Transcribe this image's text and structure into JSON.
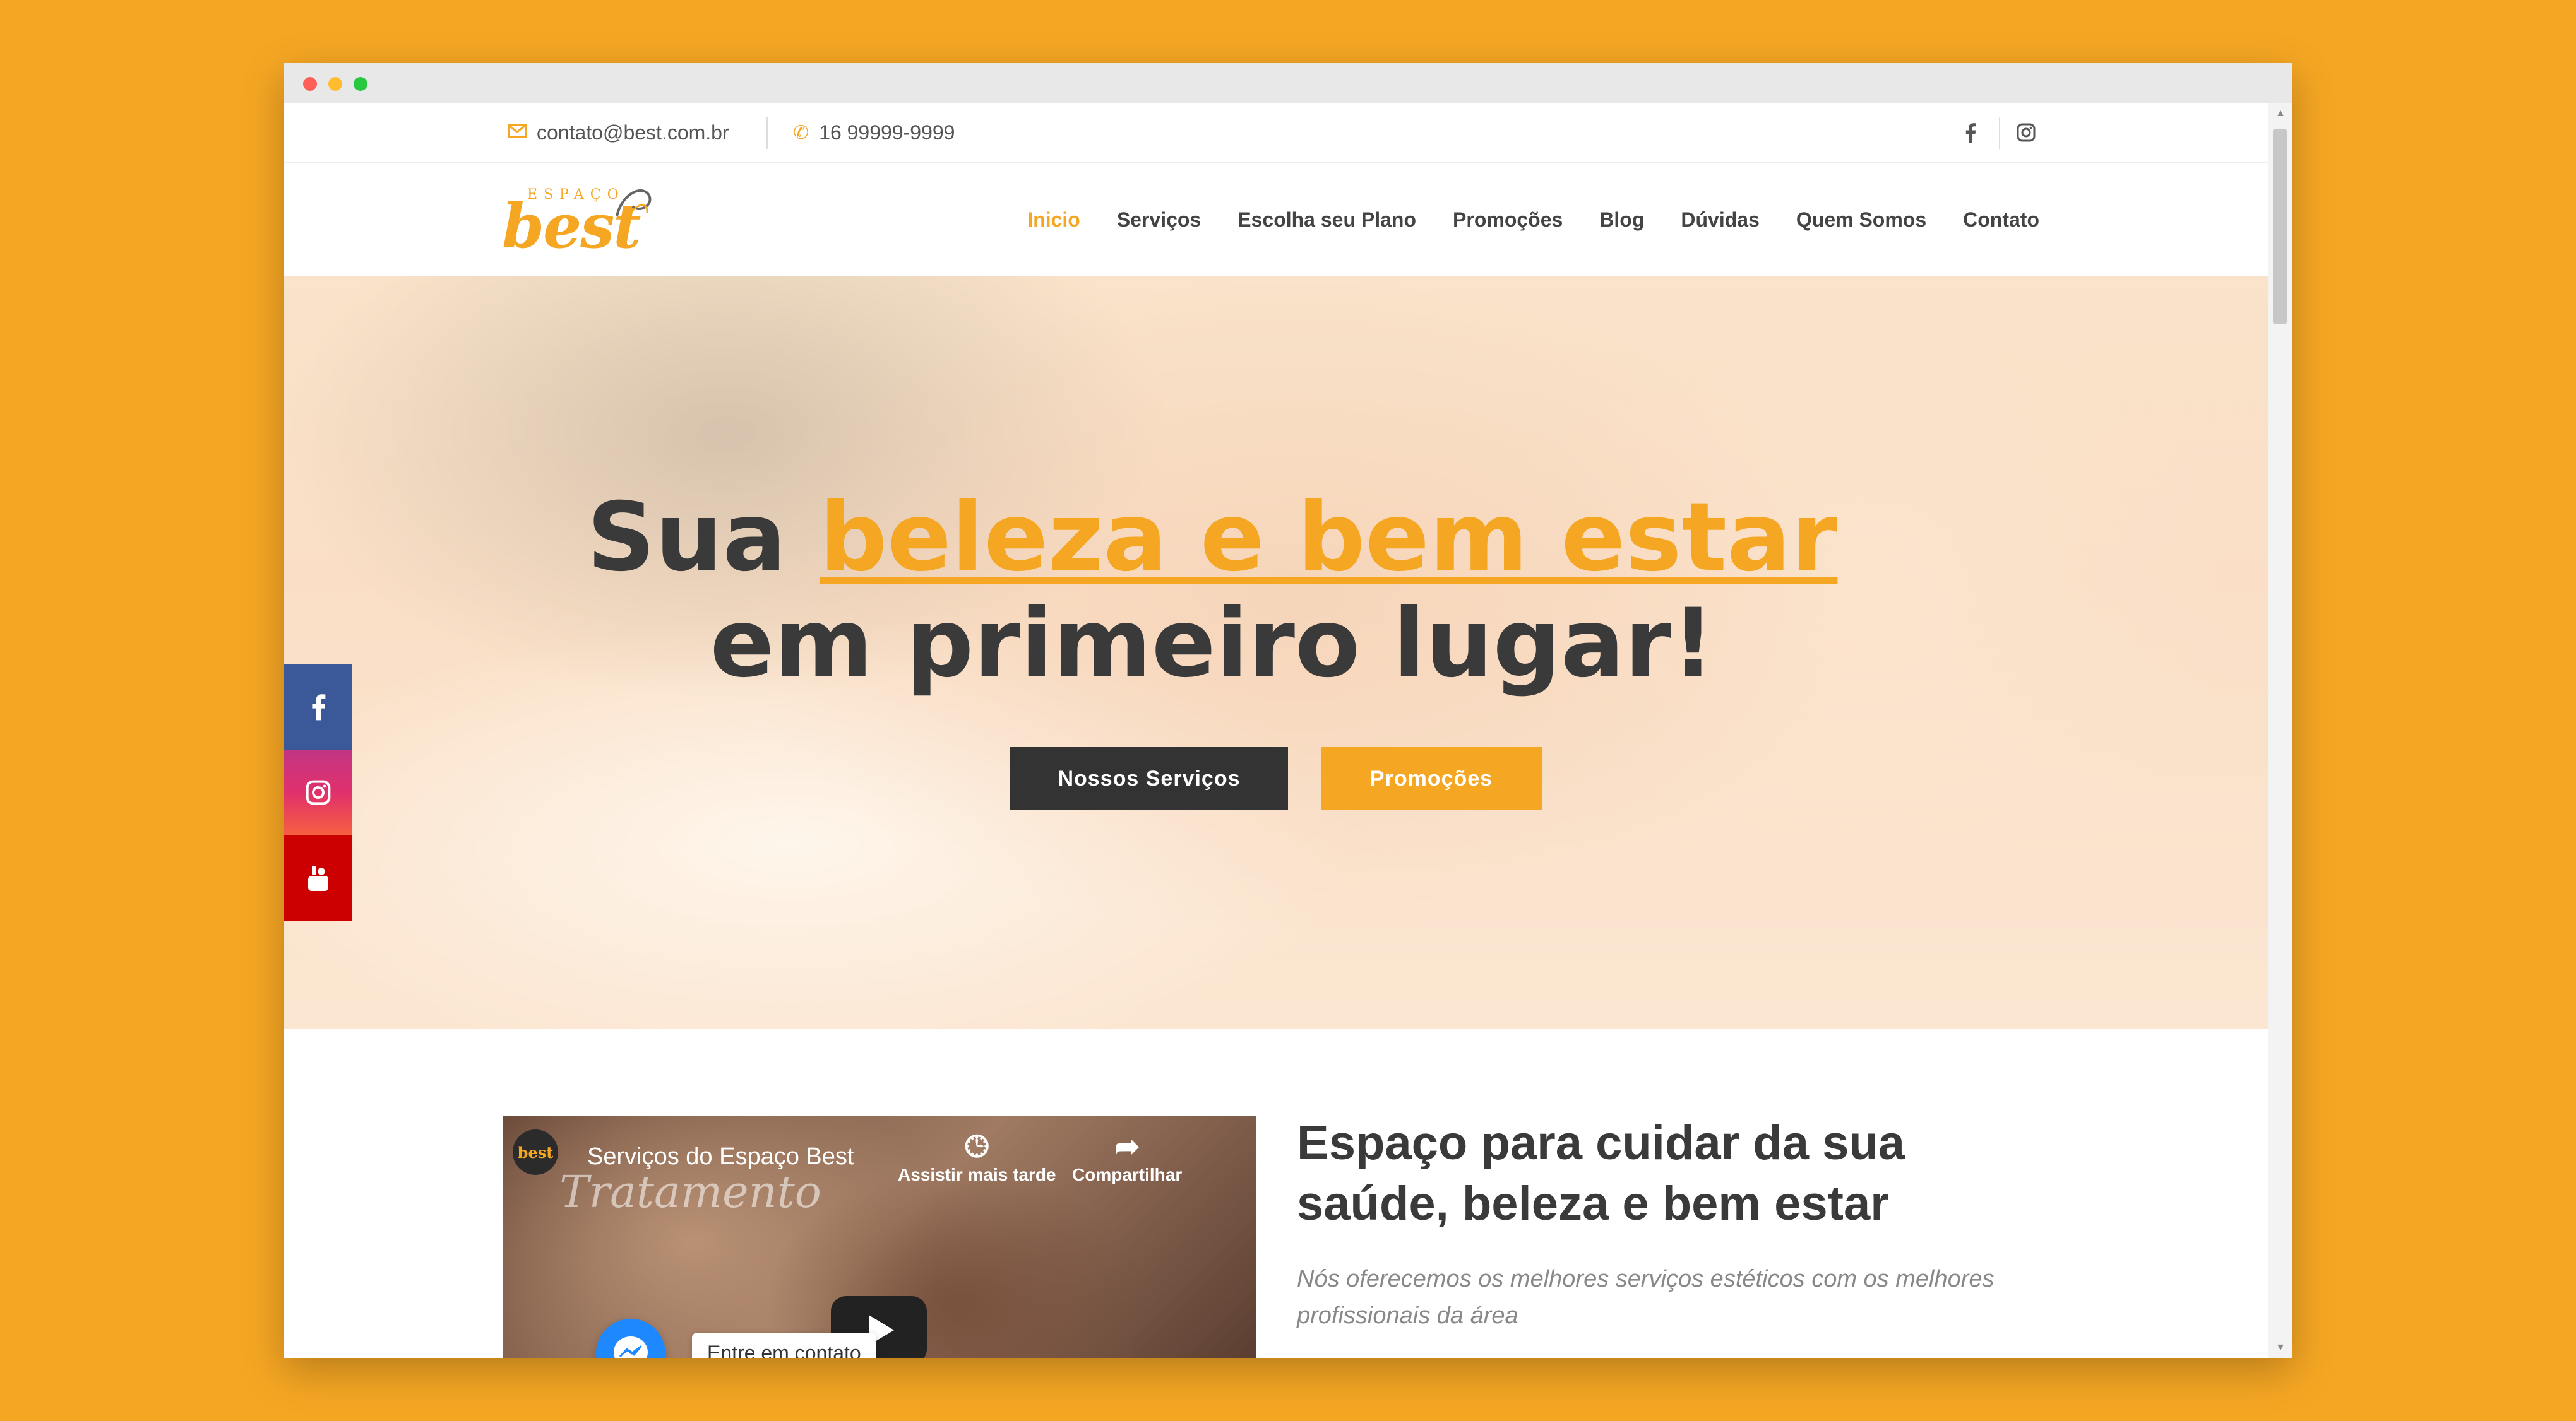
{
  "window_dots": {
    "red": "#FF5F57",
    "yellow": "#FEBC2E",
    "green": "#28C840"
  },
  "colors": {
    "accent": "#F5A623",
    "dark": "#333333",
    "facebook": "#3b5998",
    "instagram": "#c13584",
    "youtube": "#cc0000",
    "messenger": "#1e88ff"
  },
  "topbar": {
    "email_icon": "envelope-icon",
    "email": "contato@best.com.br",
    "phone_icon": "phone-icon",
    "phone": "16 99999-9999",
    "social_icons": [
      "facebook-icon",
      "instagram-icon"
    ]
  },
  "logo": {
    "small": "ESPAÇO",
    "big": "best"
  },
  "nav": {
    "items": [
      "Inicio",
      "Serviços",
      "Escolha seu Plano",
      "Promoções",
      "Blog",
      "Dúvidas",
      "Quem Somos",
      "Contato"
    ],
    "active": "Inicio"
  },
  "hero": {
    "headline_pre": "Sua ",
    "headline_accent": "beleza e bem estar",
    "headline_line2": "em primeiro lugar!",
    "btn_services": "Nossos Serviços",
    "btn_promos": "Promoções"
  },
  "social_side": [
    "facebook-icon",
    "instagram-icon",
    "youtube-icon"
  ],
  "video": {
    "logo_text": "best",
    "title": "Serviços do Espaço Best",
    "script_text": "Tratamento",
    "watch_later": "Assistir mais tarde",
    "share": "Compartilhar"
  },
  "about": {
    "title": "Espaço para cuidar da sua saúde, beleza e bem estar",
    "subtitle": "Nós oferecemos os melhores serviços estéticos com os melhores profissionais da área"
  },
  "chat": {
    "label": "Entre em contato"
  }
}
